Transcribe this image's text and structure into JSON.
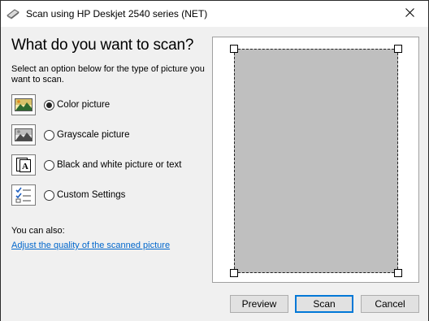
{
  "window": {
    "title": "Scan using HP Deskjet 2540 series (NET)",
    "icon": "scanner-icon"
  },
  "main": {
    "heading": "What do you want to scan?",
    "instructions": "Select an option below for the type of picture you want to scan.",
    "options": [
      {
        "label": "Color picture",
        "icon": "color-picture-icon",
        "selected": true
      },
      {
        "label": "Grayscale picture",
        "icon": "grayscale-picture-icon",
        "selected": false
      },
      {
        "label": "Black and white picture or text",
        "icon": "black-white-text-icon",
        "selected": false
      },
      {
        "label": "Custom Settings",
        "icon": "custom-settings-icon",
        "selected": false
      }
    ],
    "also_label": "You can also:",
    "link_text": "Adjust the quality of the scanned picture"
  },
  "buttons": {
    "preview": "Preview",
    "scan": "Scan",
    "cancel": "Cancel"
  },
  "colors": {
    "link": "#0066cc",
    "scan_area": "#bfbfbf",
    "primary_border": "#0078d7"
  }
}
